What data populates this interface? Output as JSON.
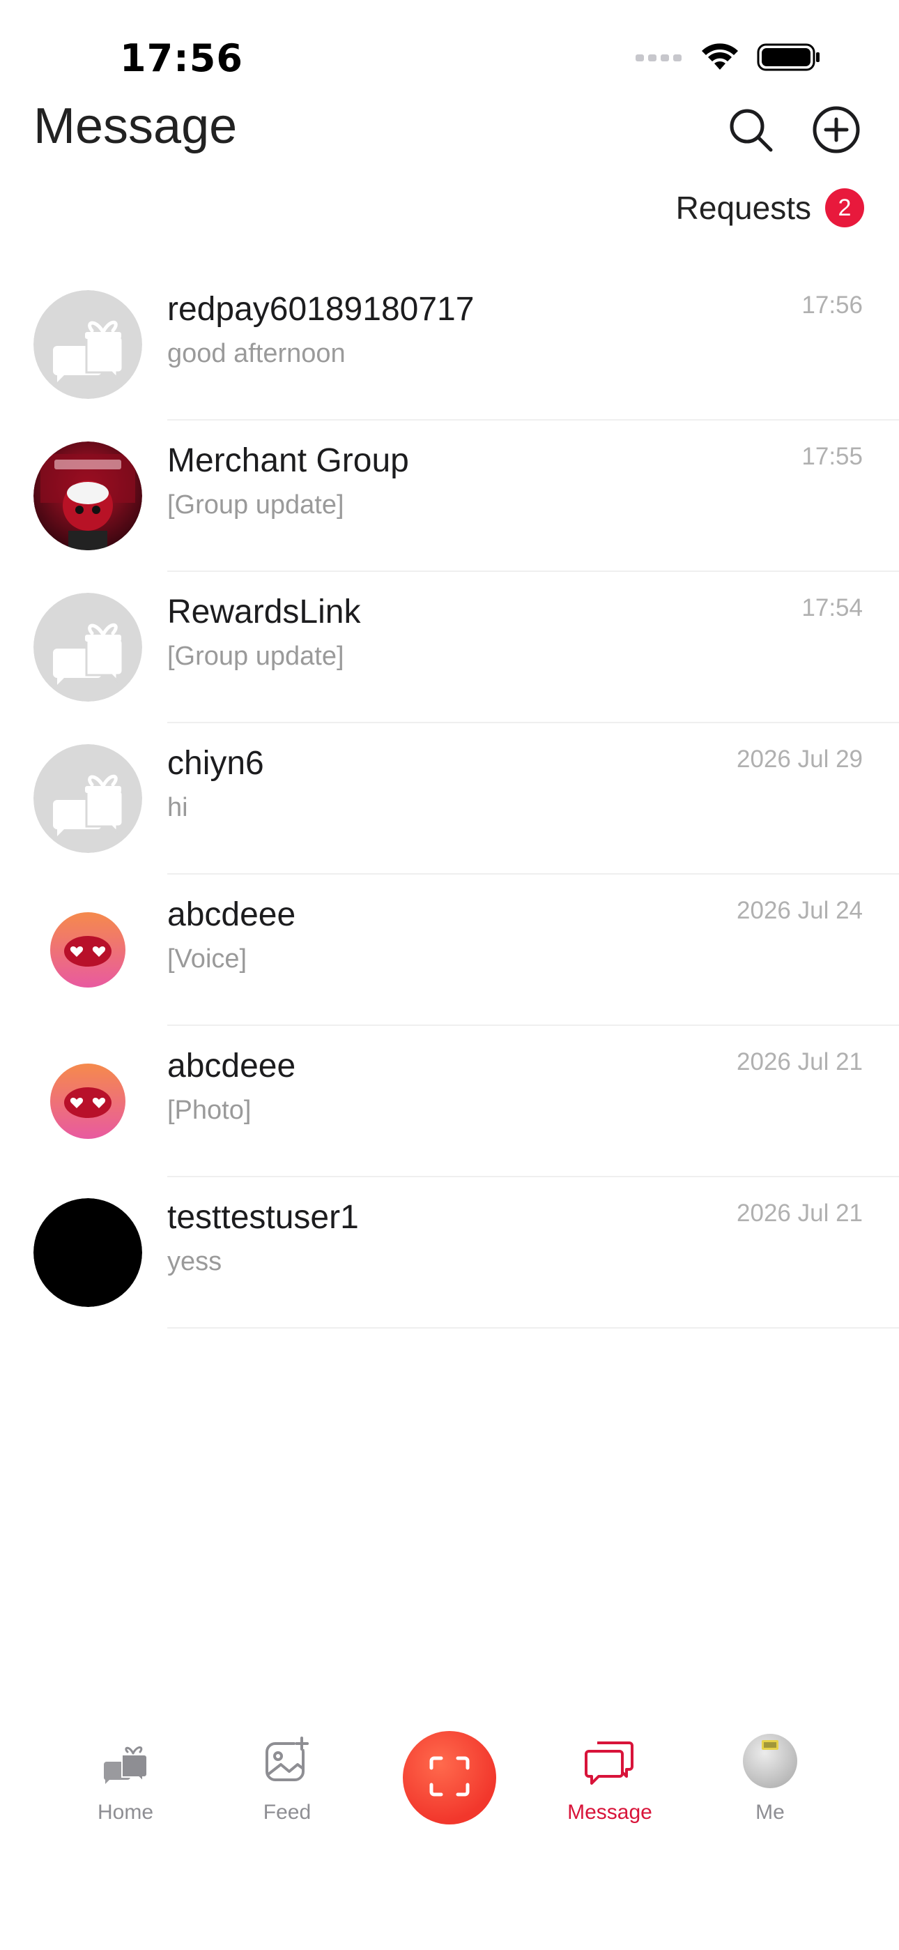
{
  "status_bar": {
    "time": "17:56"
  },
  "header": {
    "title": "Message",
    "search_icon": "search-icon",
    "add_icon": "add-circle-icon"
  },
  "requests": {
    "label": "Requests",
    "count": "2",
    "badge_color": "#e8193c"
  },
  "conversations": [
    {
      "name": "redpay60189180717",
      "preview": "good afternoon",
      "time": "17:56",
      "avatar": "gift-chat-placeholder"
    },
    {
      "name": "Merchant Group",
      "preview": "[Group update]",
      "time": "17:55",
      "avatar": "group-photo"
    },
    {
      "name": "RewardsLink",
      "preview": "[Group update]",
      "time": "17:54",
      "avatar": "gift-chat-placeholder"
    },
    {
      "name": "chiyn6",
      "preview": "hi",
      "time": "2026 Jul 29",
      "avatar": "gift-chat-placeholder"
    },
    {
      "name": "abcdeee",
      "preview": "[Voice]",
      "time": "2026 Jul 24",
      "avatar": "heart-eyes-emoji"
    },
    {
      "name": "abcdeee",
      "preview": "[Photo]",
      "time": "2026 Jul 21",
      "avatar": "heart-eyes-emoji"
    },
    {
      "name": "testtestuser1",
      "preview": "yess",
      "time": "2026 Jul 21",
      "avatar": "black-circle"
    }
  ],
  "tabbar": {
    "tabs": [
      {
        "label": "Home",
        "icon": "home-gift-chat-icon",
        "active": false
      },
      {
        "label": "Feed",
        "icon": "image-add-icon",
        "active": false
      },
      {
        "label": "Message",
        "icon": "message-bubbles-icon",
        "active": true
      },
      {
        "label": "Me",
        "icon": "avatar",
        "active": false
      }
    ],
    "scan_icon": "scan-icon",
    "active_color": "#d8143a",
    "scan_color": "#f2372c"
  }
}
